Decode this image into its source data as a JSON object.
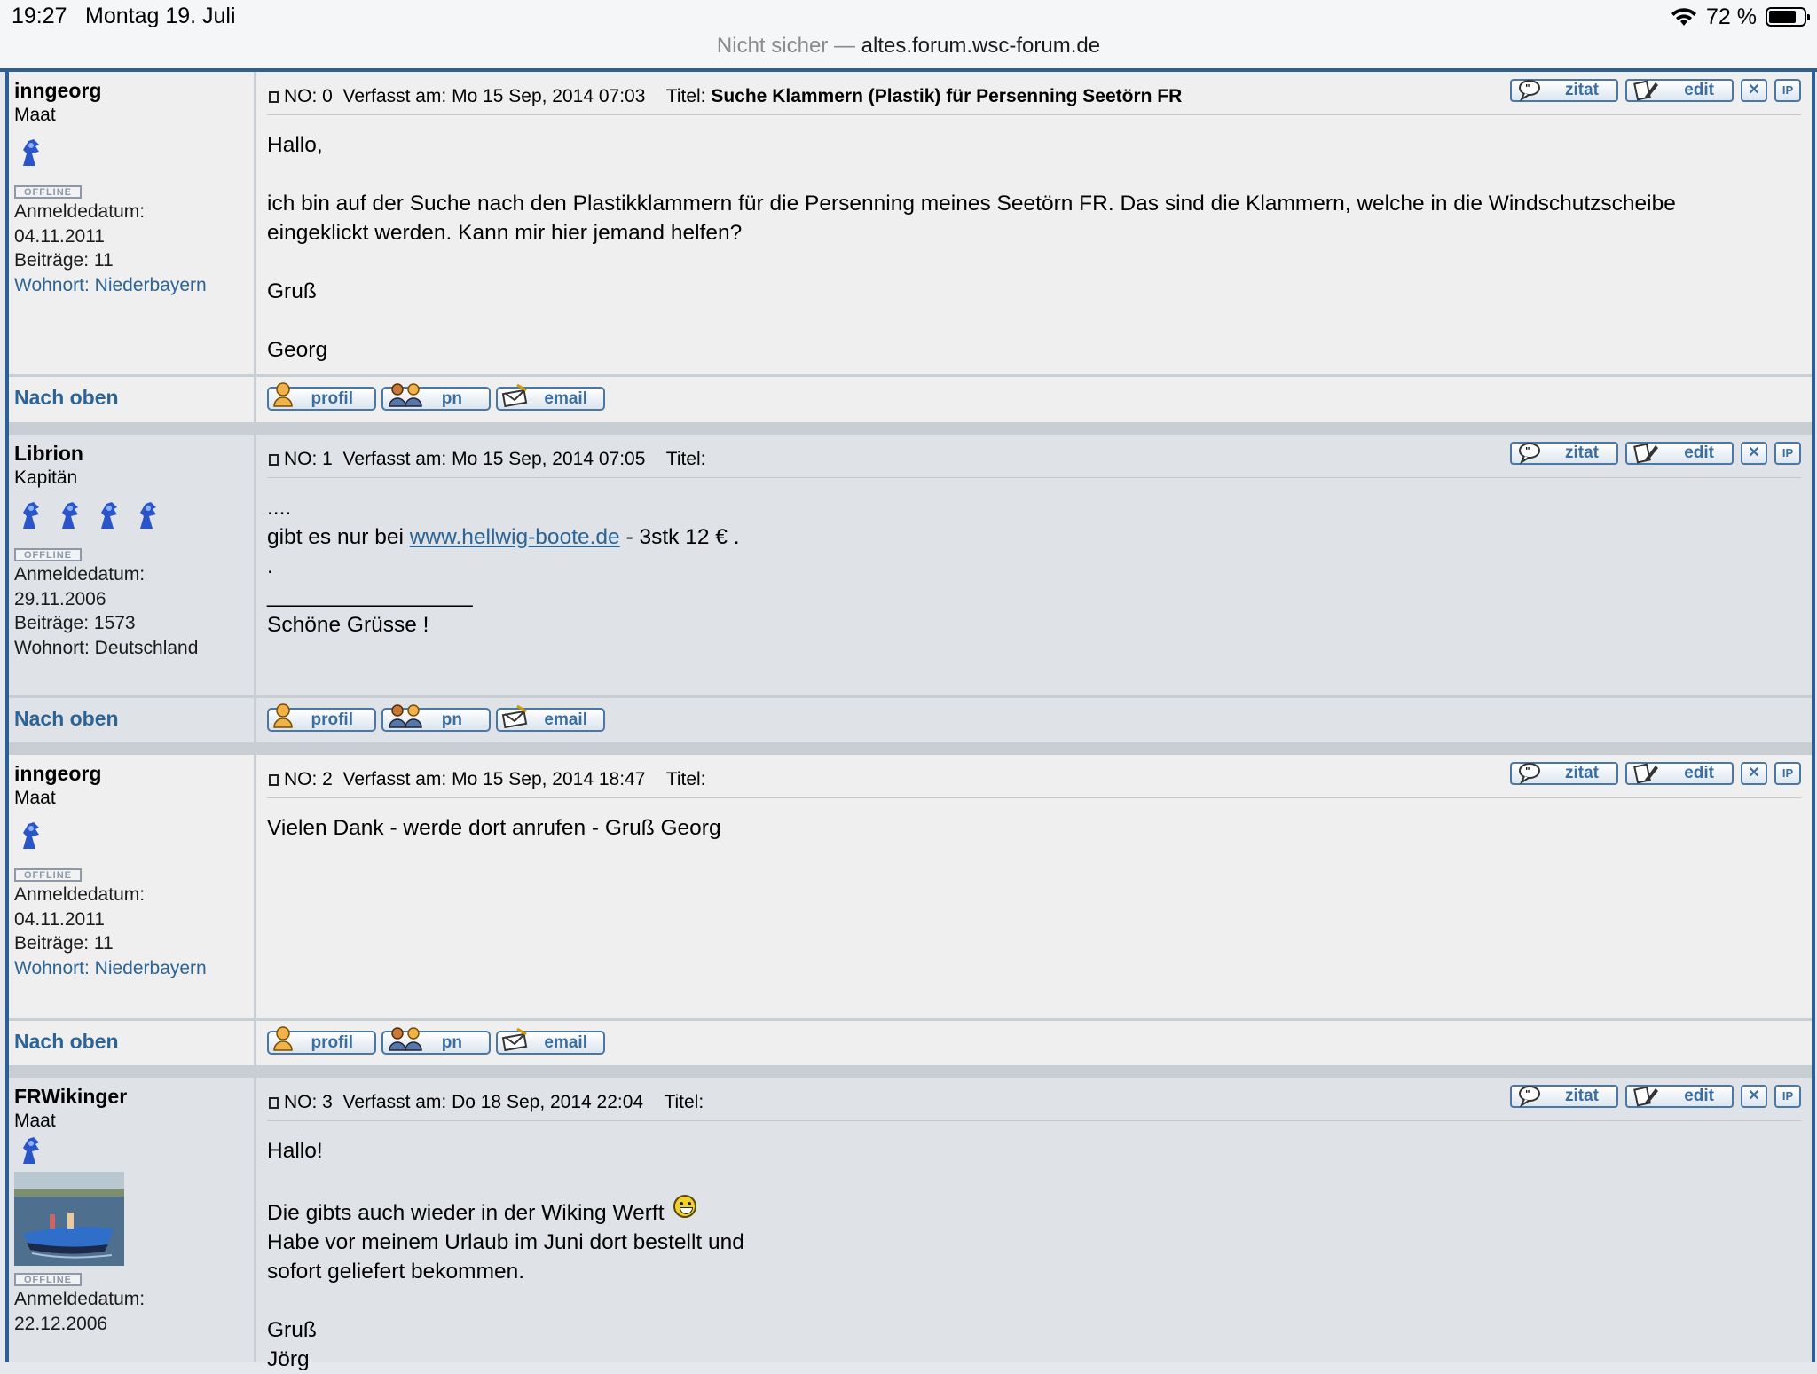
{
  "status_bar": {
    "time": "19:27",
    "date": "Montag 19. Juli",
    "battery": "72 %",
    "battery_level": 0.72
  },
  "address_bar": {
    "insecure": "Nicht sicher —",
    "host": "altes.forum.wsc-forum.de"
  },
  "labels": {
    "quote": "zitat",
    "edit": "edit",
    "delete": "✕",
    "ip": "IP",
    "top": "Nach oben",
    "profil": "profil",
    "pn": "pn",
    "email": "email",
    "offline": "OFFLINE"
  },
  "posts": [
    {
      "author": "inngeorg",
      "rank": "Maat",
      "joined_label": "Anmeldedatum:",
      "joined": "04.11.2011",
      "posts_count": "Beiträge: 11",
      "location": "Wohnort: Niederbayern",
      "header": {
        "no": "NO:  0",
        "date": "Verfasst am: Mo 15 Sep, 2014 07:03",
        "title_label": "Titel:",
        "title": "Suche Klammern (Plastik) für Persenning Seetörn FR"
      },
      "lines": [
        "Hallo,",
        "",
        "ich bin auf der Suche nach den Plastikklammern für die Persenning meines Seetörn FR. Das sind die Klammern, welche in die Windschutzscheibe",
        "eingeklickt werden. Kann mir hier jemand helfen?",
        "",
        "Gruß",
        "",
        "Georg"
      ]
    },
    {
      "author": "Librion",
      "rank": "Kapitän",
      "joined_label": "Anmeldedatum:",
      "joined": "29.11.2006",
      "posts_count": "Beiträge: 1573",
      "location": "Wohnort: Deutschland",
      "header": {
        "no": "NO:  1",
        "date": "Verfasst am: Mo 15 Sep, 2014 07:05",
        "title_label": "Titel:",
        "title": ""
      },
      "lines": [
        "....",
        "gibt es nur bei ",
        ".",
        "_________________",
        "Schöne Grüsse !"
      ],
      "link": "www.hellwig-boote.de",
      "link_suffix": " - 3stk 12 € ."
    },
    {
      "author": "inngeorg",
      "rank": "Maat",
      "joined_label": "Anmeldedatum:",
      "joined": "04.11.2011",
      "posts_count": "Beiträge: 11",
      "location": "Wohnort: Niederbayern",
      "header": {
        "no": "NO:  2",
        "date": "Verfasst am: Mo 15 Sep, 2014 18:47",
        "title_label": "Titel:",
        "title": ""
      },
      "lines": [
        "Vielen Dank - werde dort anrufen - Gruß Georg"
      ]
    },
    {
      "author": "FRWikinger",
      "rank": "Maat",
      "joined_label": "Anmeldedatum:",
      "joined": "22.12.2006",
      "header": {
        "no": "NO:  3",
        "date": "Verfasst am: Do 18 Sep, 2014 22:04",
        "title_label": "Titel:",
        "title": ""
      },
      "lines": [
        "Hallo!",
        "",
        "Die gibts auch wieder in der Wiking Werft",
        "Habe vor meinem Urlaub im Juni dort bestellt und",
        "sofort geliefert bekommen.",
        "",
        "Gruß",
        "Jörg"
      ]
    }
  ]
}
